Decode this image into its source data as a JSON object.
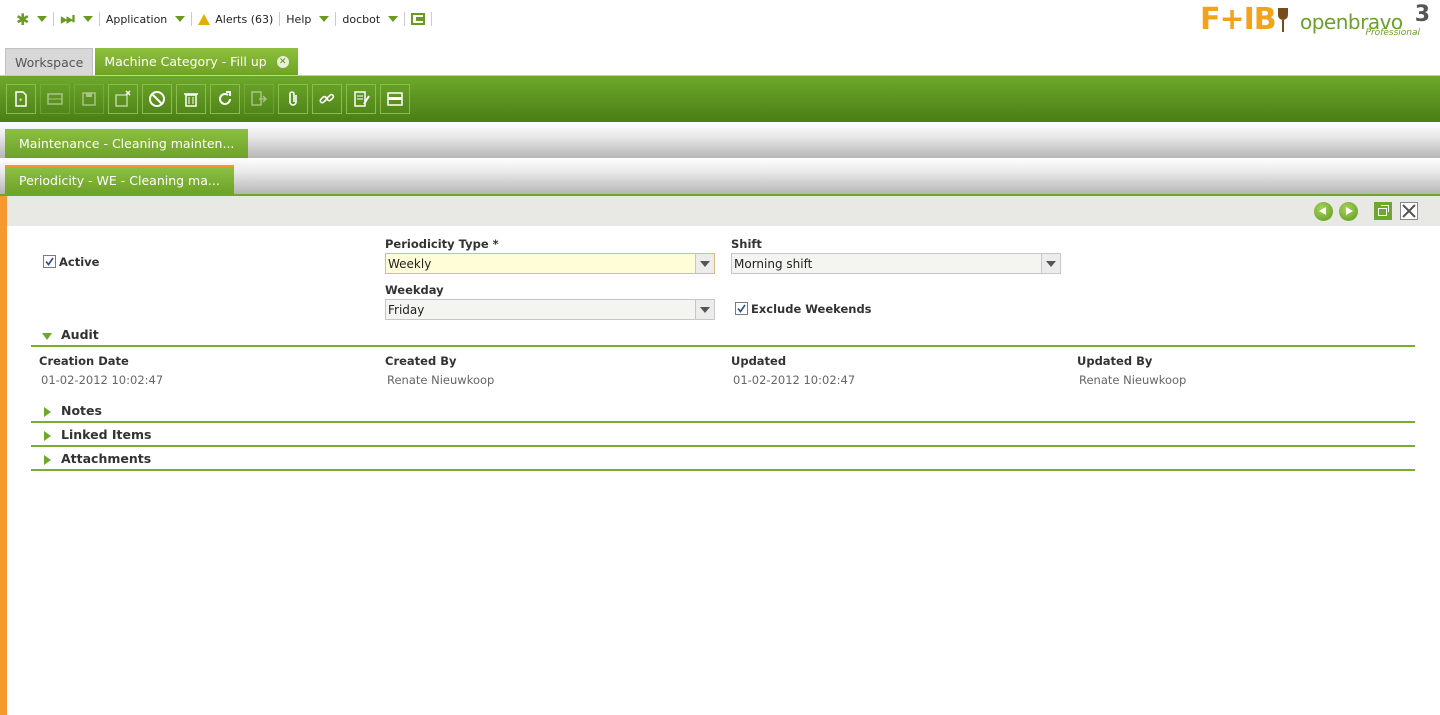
{
  "nav": {
    "application": "Application",
    "alerts": "Alerts (63)",
    "help": "Help",
    "user": "docbot"
  },
  "logos": {
    "brand1": "F+IB",
    "brand2": "openbravo",
    "version": "3",
    "edition": "Professional"
  },
  "main_tabs": [
    {
      "label": "Workspace",
      "active": false
    },
    {
      "label": "Machine Category - Fill up",
      "active": true
    }
  ],
  "toolbar": {
    "buttons": [
      "new-document",
      "new-row",
      "save",
      "save-close",
      "undo",
      "delete",
      "refresh",
      "export",
      "attach",
      "link",
      "audit-trail",
      "toggle-grid"
    ]
  },
  "sub_tabs": {
    "level1": "Maintenance - Cleaning mainten...",
    "level2": "Periodicity - WE - Cleaning ma..."
  },
  "form": {
    "active_label": "Active",
    "active_checked": true,
    "periodicity_type_label": "Periodicity Type *",
    "periodicity_type_value": "Weekly",
    "shift_label": "Shift",
    "shift_value": "Morning shift",
    "weekday_label": "Weekday",
    "weekday_value": "Friday",
    "exclude_weekends_label": "Exclude Weekends",
    "exclude_weekends_checked": true
  },
  "audit": {
    "title": "Audit",
    "creation_date_label": "Creation Date",
    "creation_date_value": "01-02-2012 10:02:47",
    "created_by_label": "Created By",
    "created_by_value": "Renate Nieuwkoop",
    "updated_label": "Updated",
    "updated_value": "01-02-2012 10:02:47",
    "updated_by_label": "Updated By",
    "updated_by_value": "Renate Nieuwkoop"
  },
  "sections": {
    "notes": "Notes",
    "linked_items": "Linked Items",
    "attachments": "Attachments"
  },
  "colors": {
    "accent_green": "#6da82a",
    "accent_orange": "#f7992f",
    "focus_yellow": "#fffdd8"
  }
}
